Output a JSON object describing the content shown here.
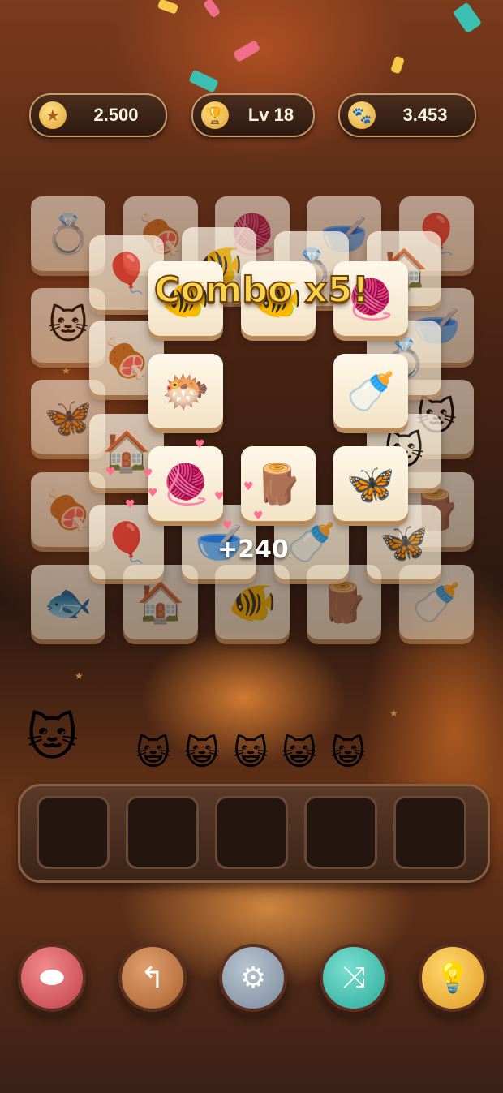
{
  "hud": {
    "stars": {
      "value": "2.500",
      "icon": "star-icon"
    },
    "level": {
      "value": "Lv 18",
      "icon": "trophy-icon"
    },
    "paws": {
      "value": "3.453",
      "icon": "paw-icon"
    }
  },
  "board": {
    "combo_text": "Combo x5!",
    "score_popup": "+240"
  },
  "tray": {
    "slots": 5
  },
  "controls": {
    "undo": "undo-icon",
    "back": "back-arrow-icon",
    "settings": "gear-icon",
    "shuffle": "shuffle-icon",
    "hint": "lightbulb-icon"
  },
  "colors": {
    "accent": "#f8d44a",
    "tile": "#fff8ea",
    "tray": "#3c2418"
  }
}
